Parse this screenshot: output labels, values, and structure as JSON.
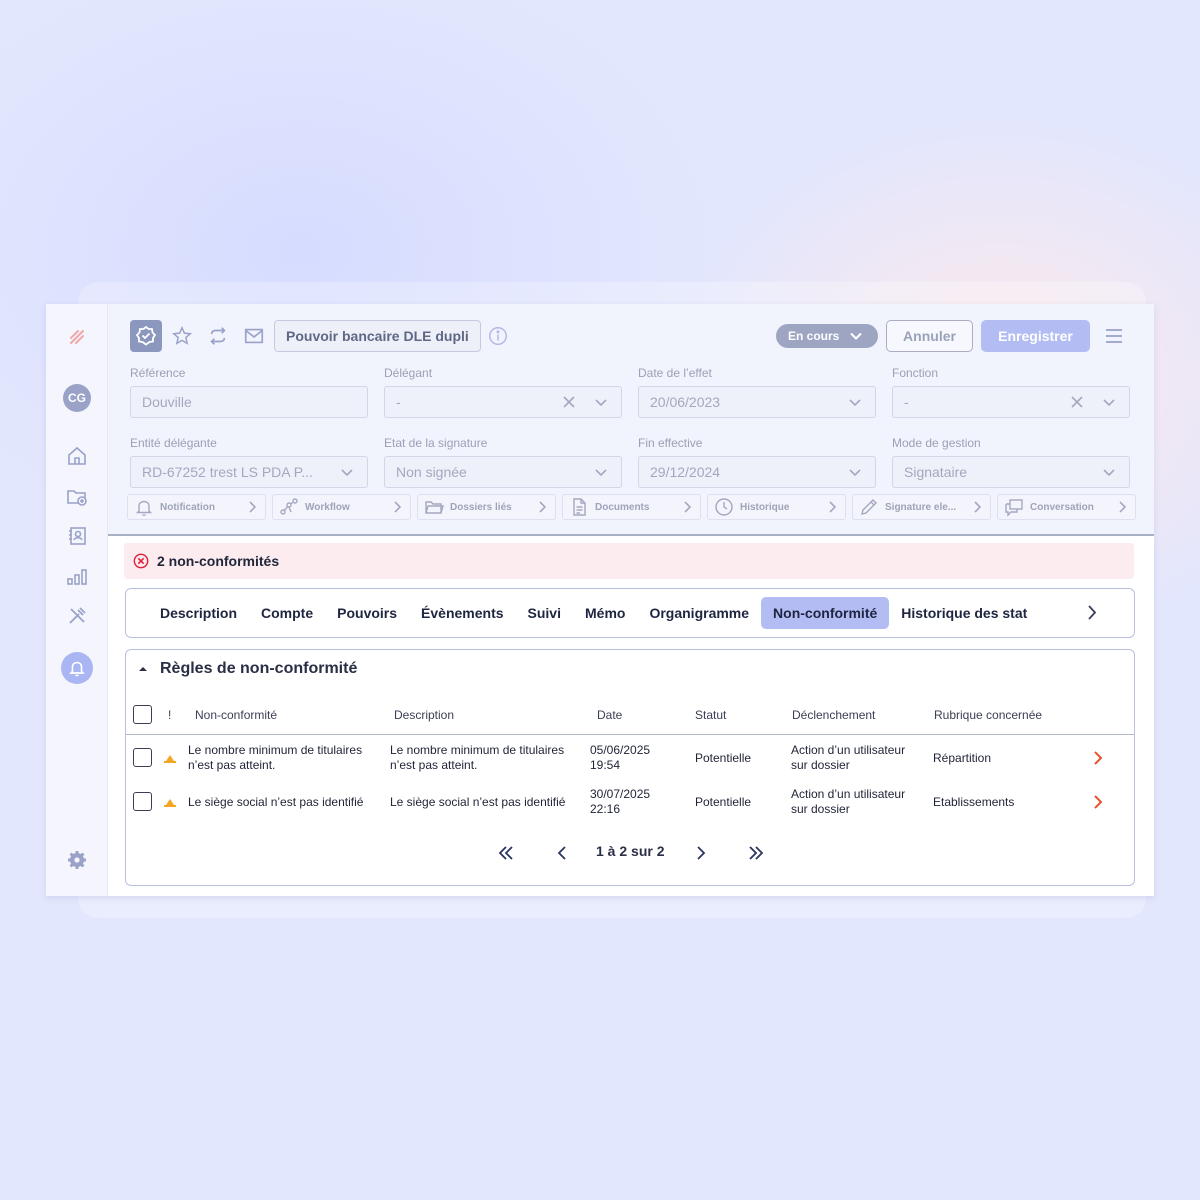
{
  "header": {
    "title": "Pouvoir bancaire DLE dupli",
    "status": "En cours",
    "cancel_label": "Annuler",
    "save_label": "Enregistrer"
  },
  "user": {
    "initials": "CG"
  },
  "fields": [
    {
      "label": "Référence",
      "value": "Douville"
    },
    {
      "label": "Délégant",
      "value": "-"
    },
    {
      "label": "Date de l’effet",
      "value": "20/06/2023"
    },
    {
      "label": "Fonction",
      "value": "-"
    },
    {
      "label": "Entité délégante",
      "value": "RD-67252 trest LS PDA P..."
    },
    {
      "label": "Etat de la signature",
      "value": "Non signée"
    },
    {
      "label": "Fin effective",
      "value": "29/12/2024"
    },
    {
      "label": "Mode de gestion",
      "value": "Signataire"
    }
  ],
  "mini_tabs": [
    {
      "label": "Notification",
      "icon": "bell-icon"
    },
    {
      "label": "Workflow",
      "icon": "workflow-icon"
    },
    {
      "label": "Dossiers liés",
      "icon": "folder-icon"
    },
    {
      "label": "Documents",
      "icon": "document-icon"
    },
    {
      "label": "Historique",
      "icon": "clock-icon"
    },
    {
      "label": "Signature ele...",
      "icon": "pen-icon"
    },
    {
      "label": "Conversation",
      "icon": "chat-icon"
    }
  ],
  "alert": {
    "text": "2 non-conformités"
  },
  "tabs": [
    {
      "label": "Description"
    },
    {
      "label": "Compte"
    },
    {
      "label": "Pouvoirs"
    },
    {
      "label": "Évènements"
    },
    {
      "label": "Suivi"
    },
    {
      "label": "Mémo"
    },
    {
      "label": "Organigramme"
    },
    {
      "label": "Non-conformité"
    },
    {
      "label": "Historique des stat"
    }
  ],
  "active_tab": "Non-conformité",
  "panel": {
    "title": "Règles de non-conformité",
    "columns": [
      "!",
      "Non-conformité",
      "Description",
      "Date",
      "Statut",
      "Déclenchement",
      "Rubrique concernée"
    ],
    "rows": [
      {
        "nonconf_1": "Le nombre minimum de titulaires",
        "nonconf_2": "n’est pas atteint.",
        "desc_1": "Le nombre minimum de titulaires",
        "desc_2": "n’est pas atteint.",
        "date_1": "05/06/2025",
        "date_2": "19:54",
        "status": "Potentielle",
        "trigger_1": "Action d’un utilisateur",
        "trigger_2": "sur dossier",
        "section": "Répartition"
      },
      {
        "nonconf_1": "Le siège social n’est pas identifié",
        "desc_1": "Le siège social n’est pas identifié",
        "date_1": "30/07/2025",
        "date_2": "22:16",
        "status": "Potentielle",
        "trigger_1": "Action d’un utilisateur",
        "trigger_2": "sur dossier",
        "section": "Etablissements"
      }
    ],
    "pagination": "1 à 2 sur 2"
  },
  "colors": {
    "accent": "#b3bdf4",
    "alert_bg": "#fdecef",
    "error": "#e0203a",
    "warning": "#f2a623",
    "arrow": "#e6532e"
  }
}
